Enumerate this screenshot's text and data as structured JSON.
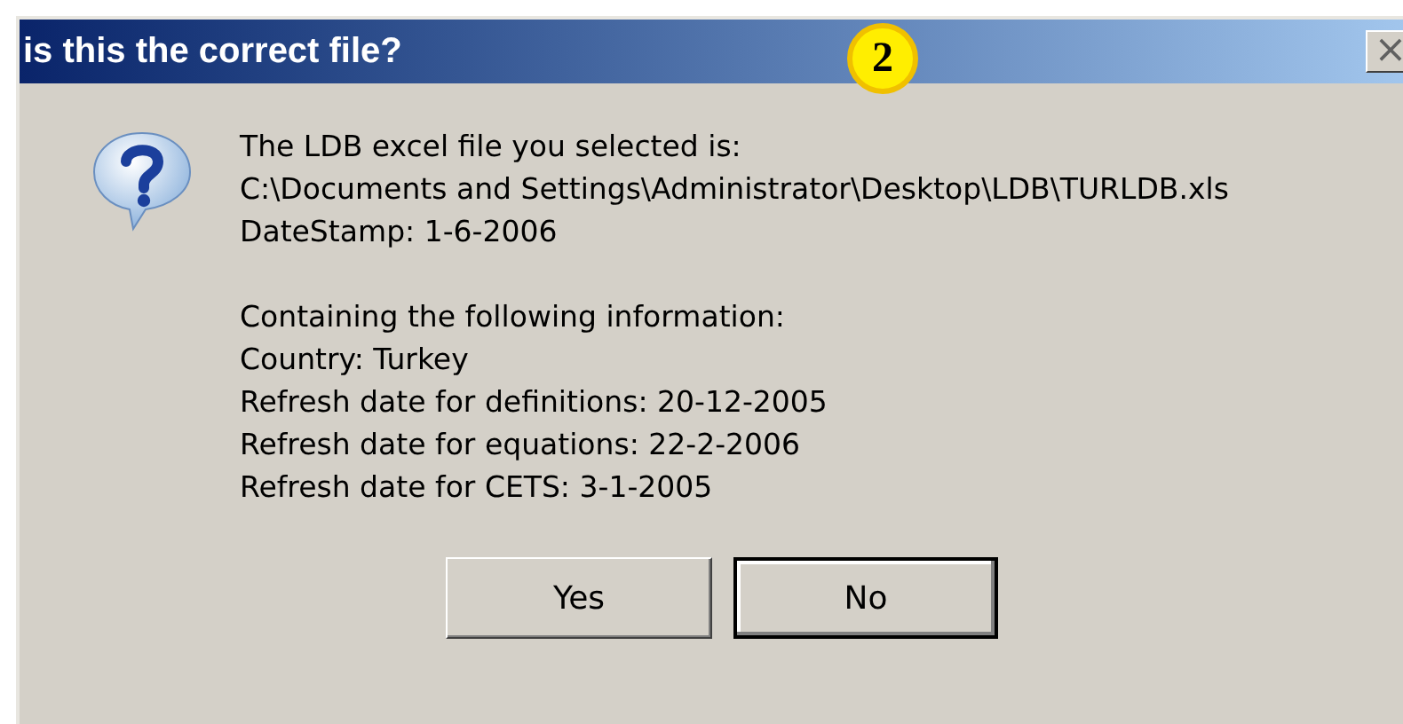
{
  "window": {
    "title": "is this the correct file?",
    "close_label": "×"
  },
  "badge": "2",
  "paragraphs": [
    {
      "lines": [
        "The LDB excel file you selected is:",
        "C:\\Documents and Settings\\Administrator\\Desktop\\LDB\\TURLDB.xls",
        "DateStamp: 1-6-2006"
      ]
    },
    {
      "lines": [
        "Containing the following information:",
        "Country: Turkey",
        "Refresh date for definitions: 20-12-2005",
        "Refresh date for equations: 22-2-2006",
        "Refresh date for CETS: 3-1-2005"
      ]
    }
  ],
  "buttons": [
    {
      "label": "Yes",
      "default": false
    },
    {
      "label": "No",
      "default": true
    }
  ]
}
